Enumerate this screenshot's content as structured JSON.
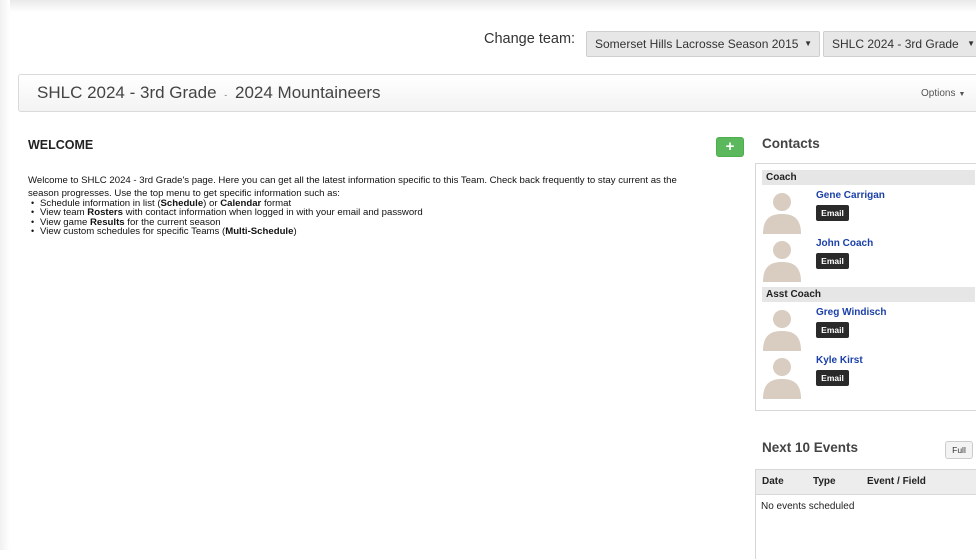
{
  "header": {
    "change_team_label": "Change team:",
    "season_select": "Somerset Hills Lacrosse Season 2015",
    "team_select": "SHLC 2024 - 3rd Grade"
  },
  "title_bar": {
    "team": "SHLC 2024 - 3rd Grade",
    "separator": "-",
    "subteam": "2024 Mountaineers",
    "options_label": "Options"
  },
  "welcome": {
    "heading": "WELCOME",
    "add_label": "+",
    "intro_line1": "Welcome to SHLC 2024 - 3rd Grade's page. Here you can get all the latest information specific to this Team. Check back frequently to stay current as the",
    "intro_line2": "season progresses. Use the top menu to get specific information such as:",
    "items": [
      {
        "pre": "Schedule information in list (",
        "bold": "Schedule",
        "mid": ") or ",
        "bold2": "Calendar",
        "post": " format"
      },
      {
        "pre": "View team ",
        "bold": "Rosters",
        "post": " with contact information when logged in with your email and password"
      },
      {
        "pre": "View game ",
        "bold": "Results",
        "post": " for the current season"
      },
      {
        "pre": "View custom schedules for specific Teams (",
        "bold": "Multi-Schedule",
        "post": ")"
      }
    ]
  },
  "contacts": {
    "heading": "Contacts",
    "email_label": "Email",
    "roles": [
      {
        "role": "Coach",
        "people": [
          "Gene Carrigan",
          "John Coach"
        ]
      },
      {
        "role": "Asst Coach",
        "people": [
          "Greg Windisch",
          "Kyle Kirst"
        ]
      }
    ]
  },
  "events": {
    "heading": "Next 10 Events",
    "full_label": "Full",
    "columns": [
      "Date",
      "Type",
      "Event / Field"
    ],
    "empty_message": "No events scheduled"
  }
}
